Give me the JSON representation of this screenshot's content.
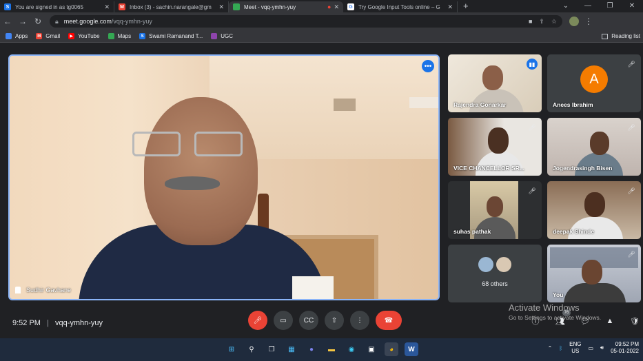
{
  "browser": {
    "tabs": [
      {
        "title": "You are signed in as tg0065",
        "fav_color": "#1a73e8",
        "fav_char": "S",
        "active": false
      },
      {
        "title": "Inbox (3) - sachin.narangale@gm",
        "fav_color": "#ea4335",
        "fav_char": "M",
        "active": false
      },
      {
        "title": "Meet - vqq-ymhn-yuy",
        "fav_color": "#34a853",
        "fav_char": "",
        "active": true
      },
      {
        "title": "Try Google Input Tools online – G",
        "fav_color": "#fff",
        "fav_char": "G",
        "active": false
      }
    ],
    "url_host": "meet.google.com",
    "url_path": "/vqq-ymhn-yuy",
    "bookmarks": [
      {
        "label": "Apps",
        "color": "#4285f4",
        "char": ""
      },
      {
        "label": "Gmail",
        "color": "#ea4335",
        "char": "M"
      },
      {
        "label": "YouTube",
        "color": "#ff0000",
        "char": "▶"
      },
      {
        "label": "Maps",
        "color": "#34a853",
        "char": ""
      },
      {
        "label": "Swami Ramanand T...",
        "color": "#1a73e8",
        "char": "S"
      },
      {
        "label": "UGC",
        "color": "#8e44ad",
        "char": ""
      }
    ],
    "reading_list": "Reading list"
  },
  "meet": {
    "main_speaker": "Sudhir Gavhane",
    "participants": [
      {
        "name": "Rajendra Gonarkar",
        "speaking": true
      },
      {
        "name": "Anees Ibrahim",
        "initial": "A",
        "muted": true
      },
      {
        "name": "VICE CHANCELLOR SR...",
        "muted": true
      },
      {
        "name": "Jogendrasingh Bisen",
        "muted": true
      },
      {
        "name": "suhas pathak",
        "muted": true
      },
      {
        "name": "deepak Shinde",
        "muted": true
      },
      {
        "name": "You",
        "muted": true
      }
    ],
    "others_label": "68 others",
    "time": "9:52 PM",
    "meeting_code": "vqq-ymhn-yuy",
    "participant_count": "76",
    "activate_title": "Activate Windows",
    "activate_sub": "Go to Settings to activate Windows."
  },
  "taskbar": {
    "lang_top": "ENG",
    "lang_bottom": "US",
    "time": "09:52 PM",
    "date": "05-01-2022"
  }
}
